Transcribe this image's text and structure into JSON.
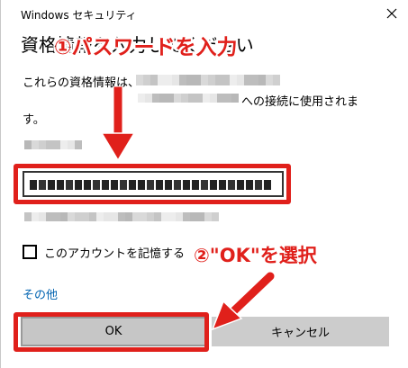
{
  "window": {
    "title": "Windows セキュリティ",
    "close_glyph": "✕"
  },
  "dialog": {
    "heading": "資格情報を入力してください",
    "description_line1": "これらの資格情報は、",
    "description_line2": "への接続に使用されま",
    "description_line3": "す。",
    "password_field_masked": true,
    "remember_label": "このアカウントを記憶する",
    "remember_checked": false,
    "more_link": "その他",
    "ok_label": "OK",
    "cancel_label": "キャンセル"
  },
  "annotations": {
    "step1": "①パスワードを入力",
    "step2": "②\"OK\"を選択",
    "color": "#e0201b"
  },
  "colors": {
    "link": "#0063b1",
    "button_bg": "#cccccc",
    "highlight": "#e0201b"
  }
}
